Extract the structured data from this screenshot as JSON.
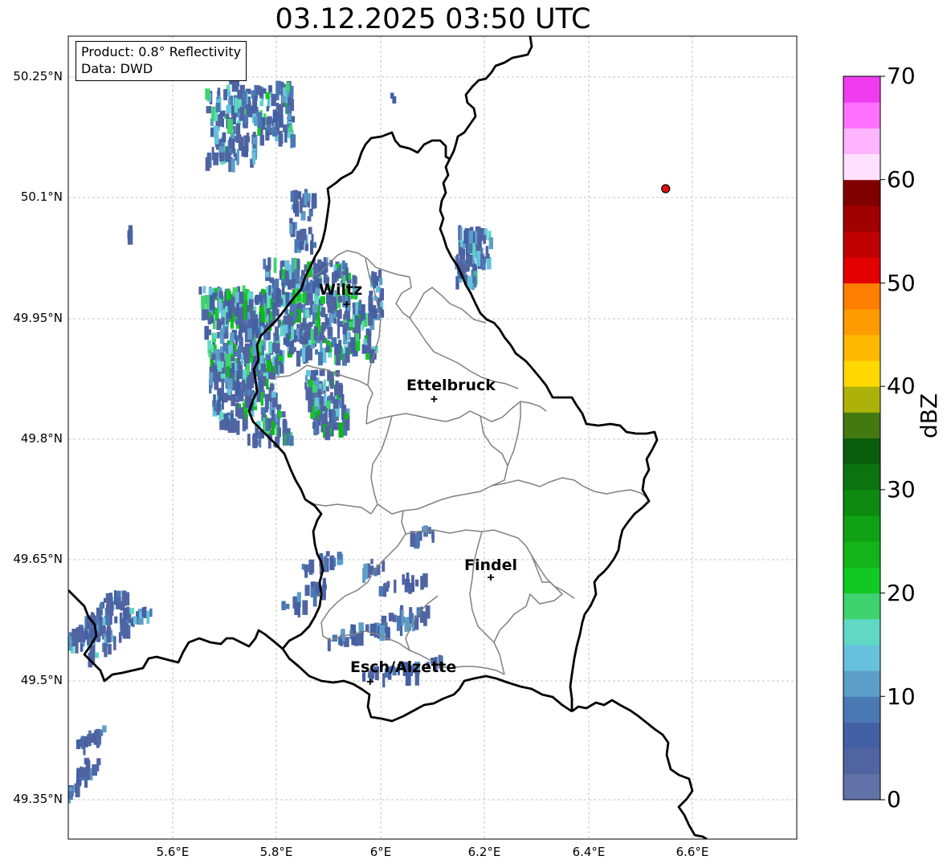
{
  "title": "03.12.2025 03:50 UTC",
  "info": {
    "product": "Product: 0.8° Reflectivity",
    "data": "Data: DWD"
  },
  "lat_labels": [
    "50.25°N",
    "50.1°N",
    "49.95°N",
    "49.8°N",
    "49.65°N",
    "49.5°N",
    "49.35°N"
  ],
  "lon_labels": [
    "5.6°E",
    "5.8°E",
    "6°E",
    "6.2°E",
    "6.4°E",
    "6.6°E"
  ],
  "cities": [
    {
      "name": "Wiltz",
      "lon": 5.935,
      "lat": 49.966
    },
    {
      "name": "Ettelbruck",
      "lon": 6.103,
      "lat": 49.848
    },
    {
      "name": "Findel",
      "lon": 6.212,
      "lat": 49.626
    },
    {
      "name": "Esch/Alzette",
      "lon": 5.98,
      "lat": 49.496
    }
  ],
  "radar_site": {
    "lon": 6.548,
    "lat": 50.11,
    "color": "#e31010"
  },
  "colorbar": {
    "label": "dBZ",
    "ticks": [
      "0",
      "10",
      "20",
      "30",
      "40",
      "50",
      "60",
      "70"
    ],
    "min": 0,
    "max": 70,
    "step": 2.5,
    "colors": [
      "#6272a8",
      "#5064a2",
      "#4460a4",
      "#4a78b2",
      "#5c9ec8",
      "#66c2dc",
      "#60d8c4",
      "#3ed36e",
      "#12c824",
      "#12b41a",
      "#10a214",
      "#0e8a10",
      "#0b7410",
      "#095c0c",
      "#447810",
      "#adb20a",
      "#fed800",
      "#fdb800",
      "#fd9c00",
      "#fd7e00",
      "#e20000",
      "#c00000",
      "#a00000",
      "#800000",
      "#ffe0ff",
      "#ffb4ff",
      "#ff70ff",
      "#ee3cee"
    ]
  },
  "map_extent": {
    "lon_min": 5.4,
    "lon_max": 6.8,
    "lat_min": 49.3,
    "lat_max": 50.3
  },
  "colors": {
    "border": "#000000",
    "admin": "#808080",
    "grid": "#b4b4b4"
  }
}
